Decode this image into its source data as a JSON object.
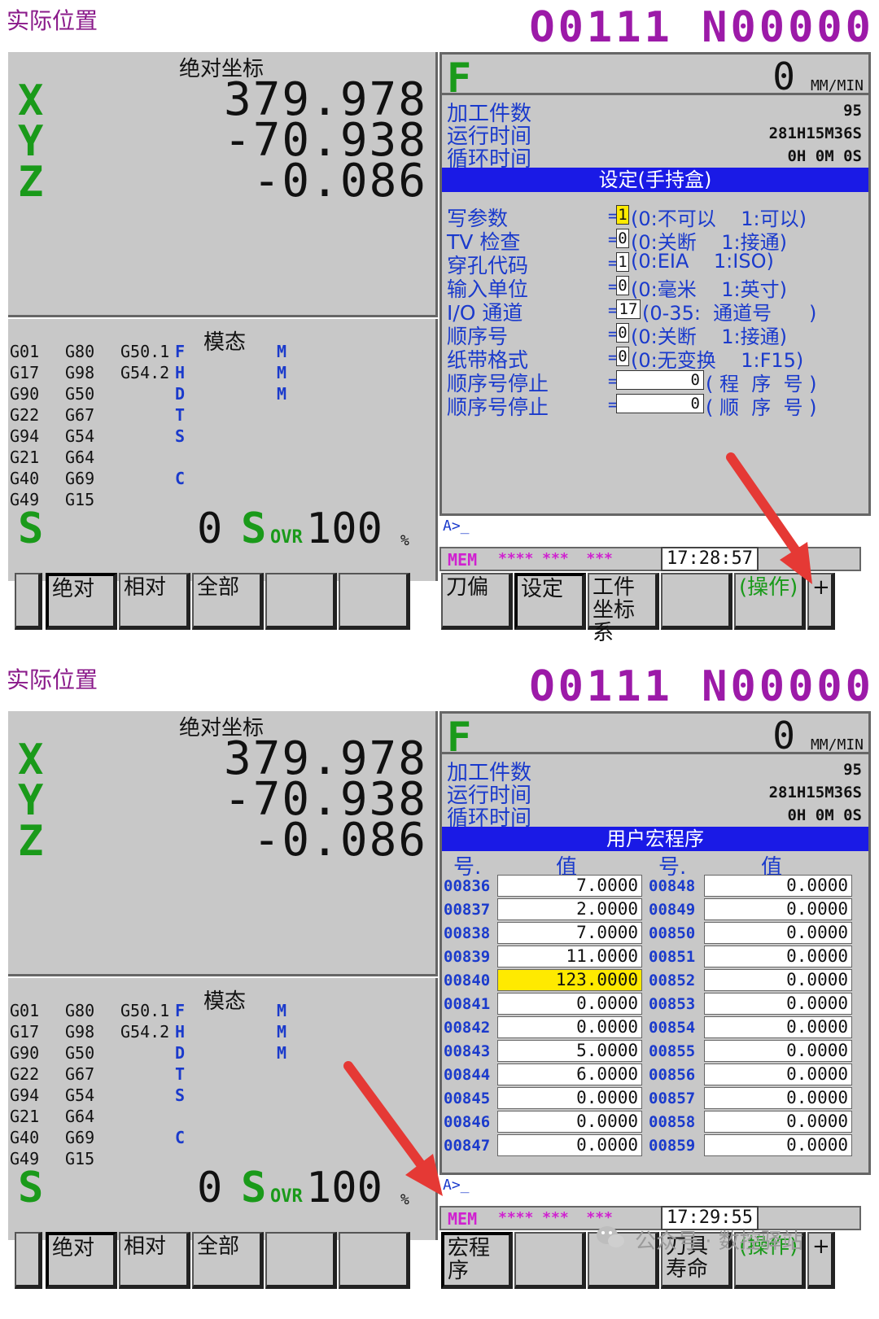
{
  "screens": [
    {
      "title": "实际位置",
      "program": "O0111 N00000",
      "abs_header": "绝对坐标",
      "axes": [
        {
          "name": "X",
          "value": "379.978"
        },
        {
          "name": "Y",
          "value": "-70.938"
        },
        {
          "name": "Z",
          "value": "-0.086"
        }
      ],
      "modal_header": "模态",
      "gcodes": [
        [
          "G01",
          "G80",
          "G50.1"
        ],
        [
          "G17",
          "G98",
          "G54.2"
        ],
        [
          "G90",
          "G50",
          ""
        ],
        [
          "G22",
          "G67",
          ""
        ],
        [
          "G94",
          "G54",
          ""
        ],
        [
          "G21",
          "G64",
          ""
        ],
        [
          "G40",
          "G69",
          ""
        ],
        [
          "G49",
          "G15",
          ""
        ]
      ],
      "modal_letters": [
        "F",
        "H",
        "D",
        "T",
        "S",
        "",
        "C",
        ""
      ],
      "m_letters": [
        "M",
        "M",
        "M"
      ],
      "spindle": {
        "s": "S",
        "value": "0",
        "sovr": "S",
        "ovr_label": "OVR",
        "ovr_value": "100",
        "pct": "%"
      },
      "feed": {
        "letter": "F",
        "value": "0",
        "unit": "MM/MIN"
      },
      "info": [
        {
          "label": "加工件数",
          "value": "95"
        },
        {
          "label": "运行时间",
          "value": "281H15M36S"
        },
        {
          "label": "循环时间",
          "value": "0H 0M 0S"
        }
      ],
      "panel_title": "设定(手持盒)",
      "params": [
        {
          "label": "写参数",
          "value": "1",
          "note": "(0:不可以    1:可以)",
          "hl": true
        },
        {
          "label": "TV  检查",
          "value": "0",
          "note": "(0:关断    1:接通)"
        },
        {
          "label": "穿孔代码",
          "value": "1",
          "note": "(0:EIA    1:ISO)"
        },
        {
          "label": "输入单位",
          "value": "0",
          "note": "(0:毫米    1:英寸)"
        },
        {
          "label": "I/O  通道",
          "value": "17",
          "note": "(0-35:  通道号      )"
        },
        {
          "label": "顺序号",
          "value": "0",
          "note": "(0:关断    1:接通)"
        },
        {
          "label": "纸带格式",
          "value": "0",
          "note": "(0:无变换    1:F15)"
        },
        {
          "label": "顺序号停止",
          "value": "0",
          "note": "( 程  序  号 )"
        },
        {
          "label": "顺序号停止",
          "value": "0",
          "note": "( 顺  序  号 )"
        }
      ],
      "input": "A>_",
      "status": {
        "mode": "MEM",
        "stars": "**** ***  ***",
        "time": "17:28:57"
      },
      "softkeys_left": [
        "",
        "绝对",
        "相对",
        "全部",
        "",
        ""
      ],
      "softkeys_right": [
        "刀偏",
        "设定",
        "工件坐标系",
        "",
        "(操作)",
        "+"
      ]
    },
    {
      "title": "实际位置",
      "program": "O0111 N00000",
      "abs_header": "绝对坐标",
      "axes": [
        {
          "name": "X",
          "value": "379.978"
        },
        {
          "name": "Y",
          "value": "-70.938"
        },
        {
          "name": "Z",
          "value": "-0.086"
        }
      ],
      "modal_header": "模态",
      "feed": {
        "letter": "F",
        "value": "0",
        "unit": "MM/MIN"
      },
      "info": [
        {
          "label": "加工件数",
          "value": "95"
        },
        {
          "label": "运行时间",
          "value": "281H15M36S"
        },
        {
          "label": "循环时间",
          "value": "0H 0M 0S"
        }
      ],
      "panel_title": "用户宏程序",
      "macro_headers": [
        "号.",
        "值",
        "号.",
        "值"
      ],
      "macro_rows": [
        [
          "00836",
          "7.0000",
          "00848",
          "0.0000"
        ],
        [
          "00837",
          "2.0000",
          "00849",
          "0.0000"
        ],
        [
          "00838",
          "7.0000",
          "00850",
          "0.0000"
        ],
        [
          "00839",
          "11.0000",
          "00851",
          "0.0000"
        ],
        [
          "00840",
          "123.0000",
          "00852",
          "0.0000"
        ],
        [
          "00841",
          "0.0000",
          "00853",
          "0.0000"
        ],
        [
          "00842",
          "0.0000",
          "00854",
          "0.0000"
        ],
        [
          "00843",
          "5.0000",
          "00855",
          "0.0000"
        ],
        [
          "00844",
          "6.0000",
          "00856",
          "0.0000"
        ],
        [
          "00845",
          "0.0000",
          "00857",
          "0.0000"
        ],
        [
          "00846",
          "0.0000",
          "00858",
          "0.0000"
        ],
        [
          "00847",
          "0.0000",
          "00859",
          "0.0000"
        ]
      ],
      "input": "A>_",
      "status": {
        "mode": "MEM",
        "stars": "**** ***  ***",
        "time": "17:29:55"
      },
      "softkeys_left": [
        "",
        "绝对",
        "相对",
        "全部",
        "",
        ""
      ],
      "softkeys_right": [
        "宏程序",
        "",
        "",
        "刀具寿命",
        "(操作)",
        "+"
      ]
    }
  ],
  "watermark": "公众号 · 数控驿站",
  "colors": {
    "panel": "#c8c8c8",
    "axis": "#1a9a1a",
    "blue": "#1a3acc",
    "title_bar": "#1a1ae6",
    "prog": "#9c1aa8",
    "highlight": "#ffea00",
    "arrow": "#e53935"
  }
}
